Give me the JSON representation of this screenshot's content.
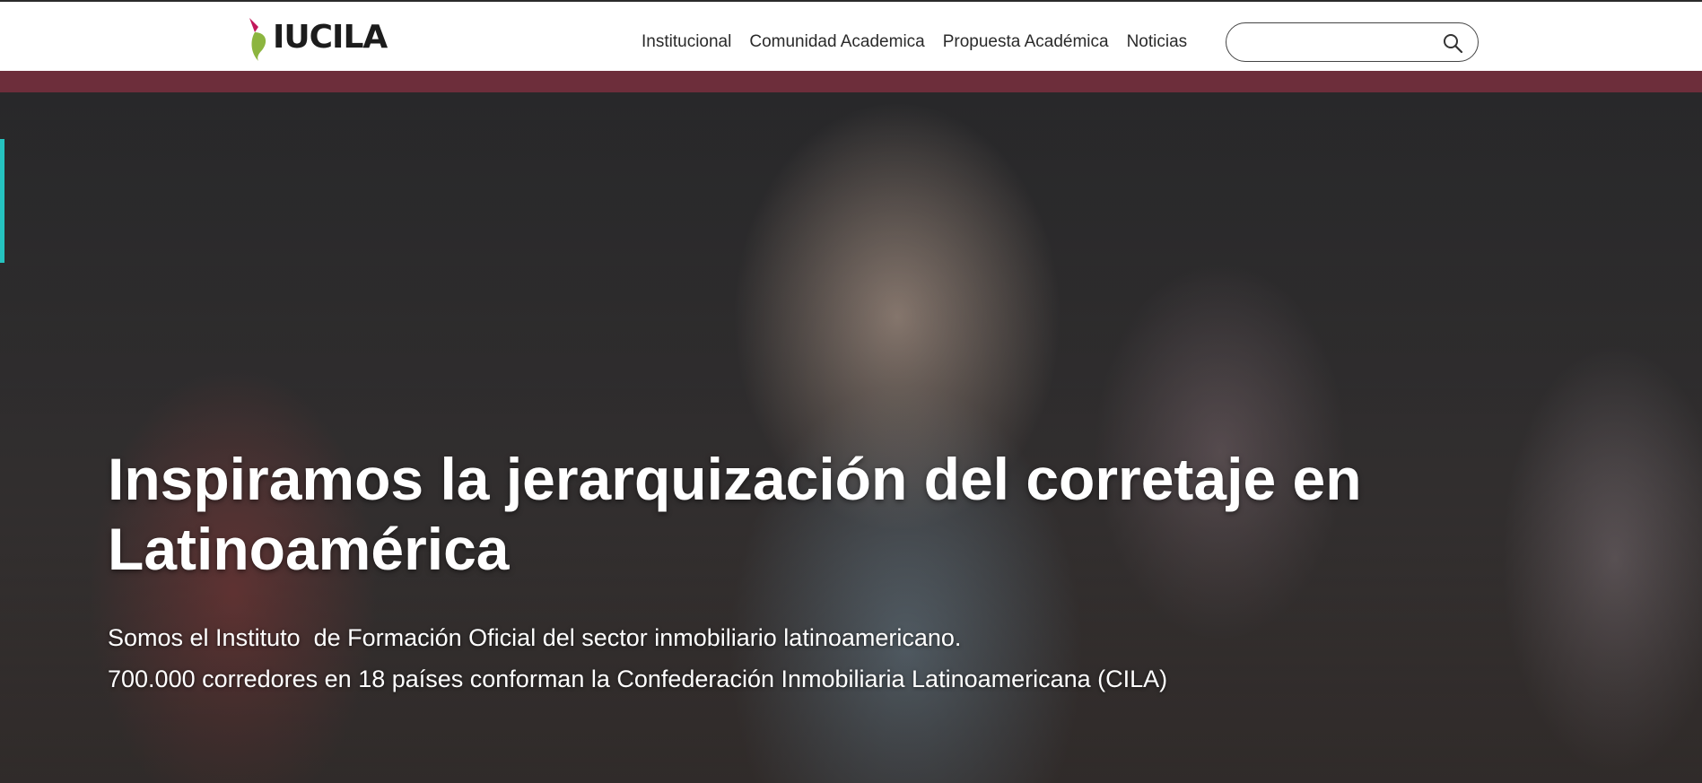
{
  "brand": {
    "logo_text": "IUCILA"
  },
  "nav": {
    "items": [
      {
        "label": "Institucional"
      },
      {
        "label": "Comunidad Academica"
      },
      {
        "label": "Propuesta Académica"
      },
      {
        "label": "Noticias"
      }
    ]
  },
  "search": {
    "value": "",
    "placeholder": "",
    "icon": "search-icon"
  },
  "hero": {
    "headline": "Inspiramos la jerarquización del corretaje en Latinoamérica",
    "sub_line_1": "Somos el Instituto  de Formación Oficial del sector inmobiliario latinoamericano.",
    "sub_line_2": "700.000 corredores en 18 países conforman la Confederación Inmobiliaria Latinoamericana (CILA)"
  },
  "colors": {
    "accent_band": "#6d2e3b",
    "logo_green": "#8cb53f",
    "logo_magenta": "#c2185b",
    "left_marker": "#25c3c0"
  }
}
